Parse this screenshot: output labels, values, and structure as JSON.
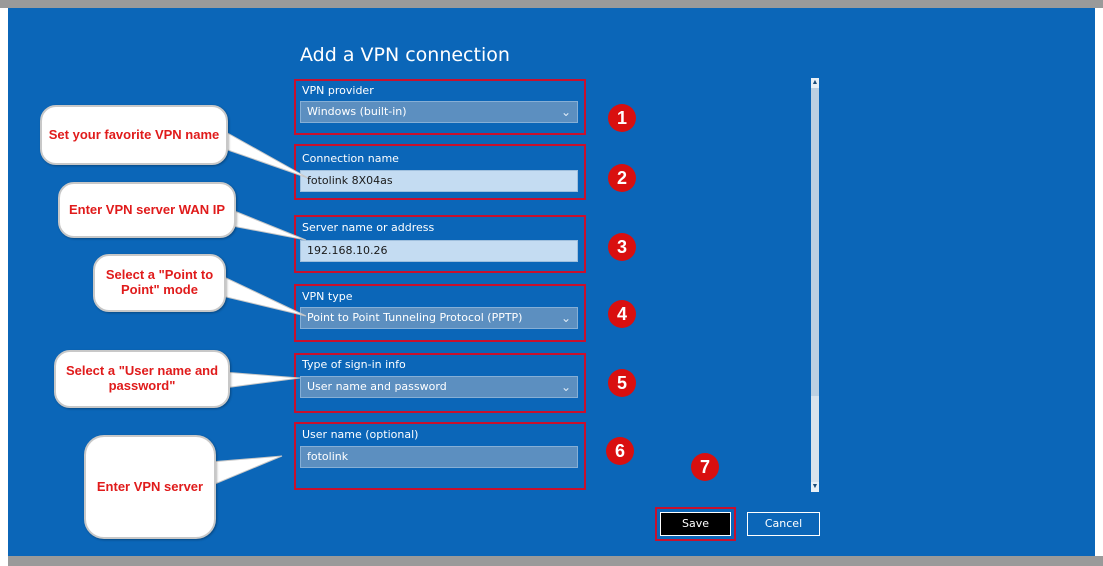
{
  "window": {
    "title": "Add a VPN connection"
  },
  "form": {
    "vpn_provider": {
      "label": "VPN provider",
      "value": "Windows (built-in)"
    },
    "connection_name": {
      "label": "Connection name",
      "value": "fotolink 8X04as"
    },
    "server_address": {
      "label": "Server name or address",
      "value": "192.168.10.26"
    },
    "vpn_type": {
      "label": "VPN type",
      "value": "Point to Point Tunneling Protocol (PPTP)"
    },
    "sign_in_type": {
      "label": "Type of sign-in info",
      "value": "User name and password"
    },
    "username": {
      "label": "User name (optional)",
      "value": "fotolink"
    }
  },
  "buttons": {
    "save": "Save",
    "cancel": "Cancel"
  },
  "annotations": {
    "numbers": [
      "1",
      "2",
      "3",
      "4",
      "5",
      "6",
      "7"
    ],
    "callouts": {
      "vpn_name": "Set your favorite VPN name",
      "server_ip": "Enter VPN server WAN IP",
      "point_to_point": "Select a \"Point to Point\" mode",
      "user_password": "Select a \"User name and password\"",
      "vpn_server": "Enter VPN server"
    }
  },
  "icons": {
    "dropdown": "chevron-down-icon",
    "scroll_up": "arrow-up-icon",
    "scroll_down": "arrow-down-icon"
  },
  "colors": {
    "background": "#0b66b8",
    "annotation_red": "#d90f0f"
  }
}
